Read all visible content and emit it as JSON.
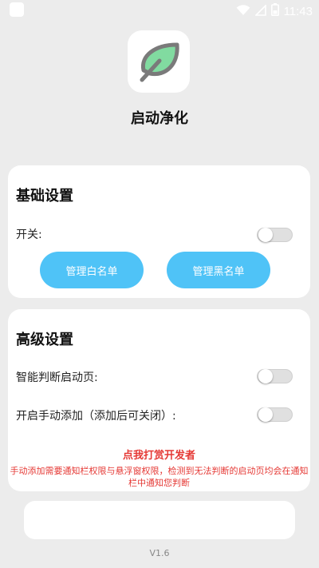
{
  "status_bar": {
    "time": "11:43",
    "icons": [
      "app-square-icon",
      "wifi-icon",
      "signal-icon",
      "battery-icon"
    ]
  },
  "header": {
    "logo_icon": "leaf-icon",
    "app_name": "启动净化"
  },
  "basic_settings": {
    "title": "基础设置",
    "switch_label": "开关:",
    "switch_on": false,
    "whitelist_button": "管理白名单",
    "blacklist_button": "管理黑名单"
  },
  "advanced_settings": {
    "title": "高级设置",
    "smart_detect_label": "智能判断启动页:",
    "smart_detect_on": false,
    "manual_add_label": "开启手动添加（添加后可关闭）:",
    "manual_add_on": false,
    "donate_link": "点我打赏开发者",
    "notice": "手动添加需要通知栏权限与悬浮窗权限，检测到无法判断的启动页均会在通知栏中通知您判断"
  },
  "footer": {
    "version": "V1.6"
  },
  "colors": {
    "accent": "#4fc3f7",
    "warning": "#e53935",
    "background": "#ececec",
    "leaf_fill": "#81dba0",
    "leaf_stroke": "#7a7a7a"
  }
}
